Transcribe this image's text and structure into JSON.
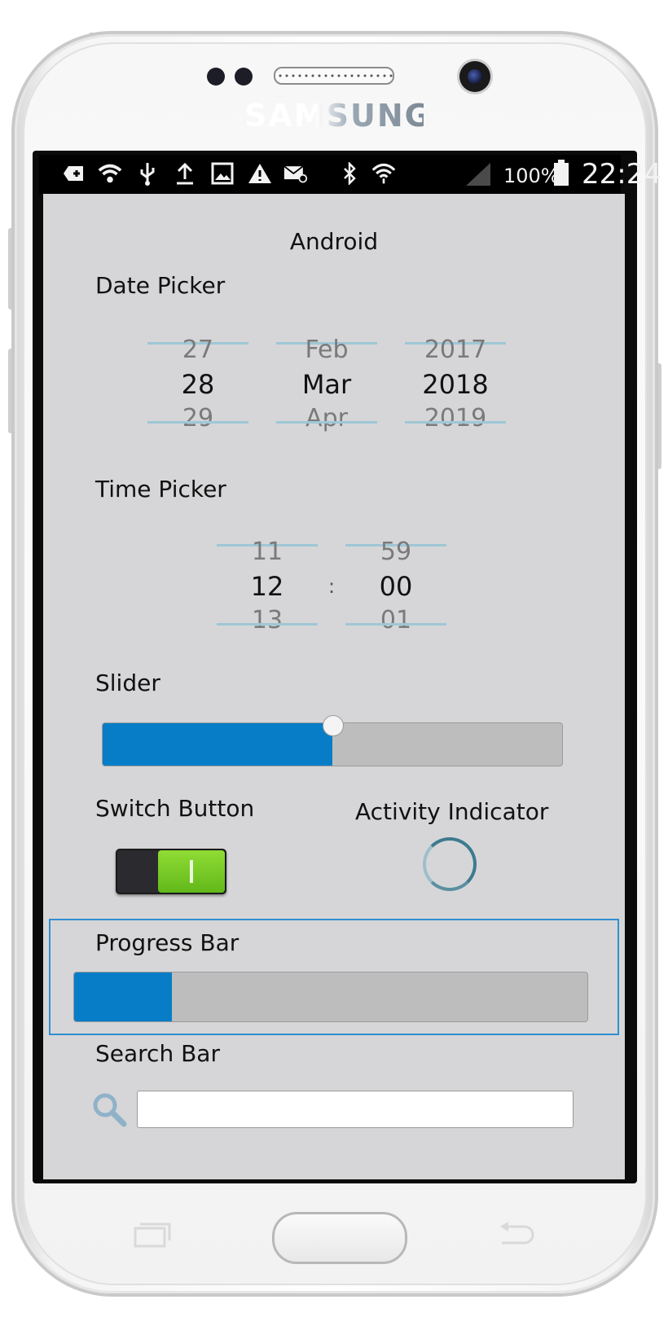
{
  "device": {
    "brand": "SAMSUNG"
  },
  "statusbar": {
    "icons": [
      "add-icon",
      "wifi-info-icon",
      "usb-icon",
      "upload-icon",
      "image-icon",
      "warning-icon",
      "email-icon",
      "bluetooth-icon",
      "wifi-icon",
      "signal-icon"
    ],
    "battery": "100%",
    "time": "22:24"
  },
  "page": {
    "title": "Android"
  },
  "date_picker": {
    "label": "Date Picker",
    "day": {
      "prev": "27",
      "current": "28",
      "next": "29"
    },
    "month": {
      "prev": "Feb",
      "current": "Mar",
      "next": "Apr"
    },
    "year": {
      "prev": "2017",
      "current": "2018",
      "next": "2019"
    }
  },
  "time_picker": {
    "label": "Time Picker",
    "hour": {
      "prev": "11",
      "current": "12",
      "next": "13"
    },
    "separator": ":",
    "minute": {
      "prev": "59",
      "current": "00",
      "next": "01"
    }
  },
  "slider": {
    "label": "Slider",
    "value": 0.5
  },
  "switch_button": {
    "label": "Switch Button",
    "on": true
  },
  "activity_indicator": {
    "label": "Activity Indicator"
  },
  "progress_bar": {
    "label": "Progress Bar",
    "value": 0.19
  },
  "search_bar": {
    "label": "Search Bar",
    "value": "",
    "placeholder": ""
  },
  "colors": {
    "accent": "#087dc7",
    "switch_on": "#6cc11f",
    "background": "#d6d6d8"
  }
}
